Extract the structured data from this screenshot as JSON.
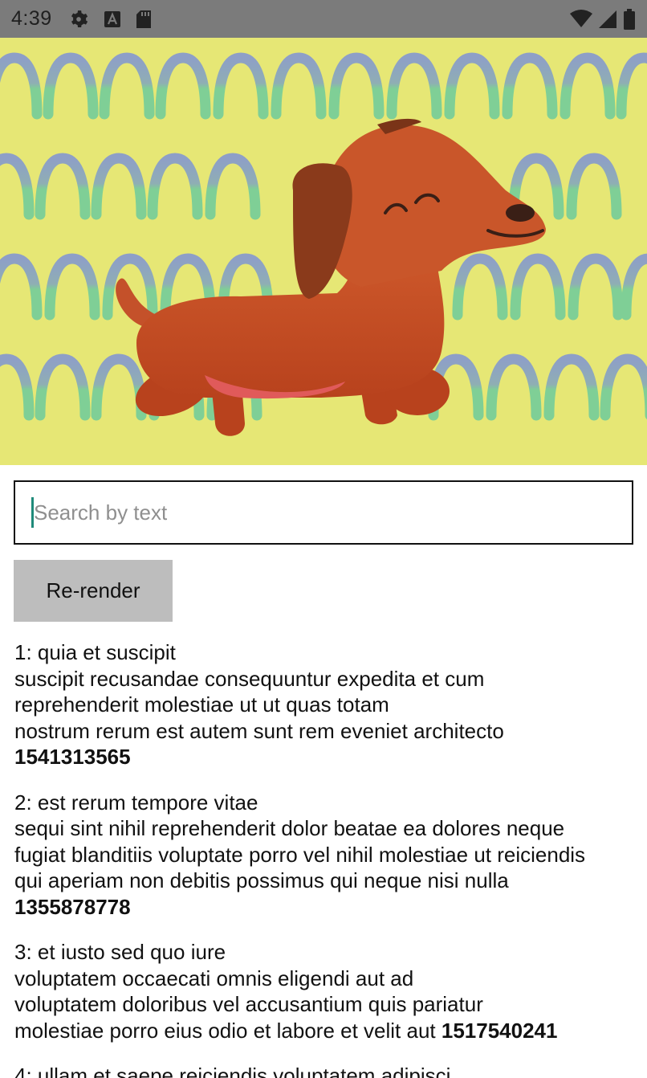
{
  "status_bar": {
    "time": "4:39",
    "left_icons": [
      "gear-icon",
      "a-icon",
      "sd-card-icon"
    ],
    "right_icons": [
      "wifi-icon",
      "signal-icon",
      "battery-icon"
    ]
  },
  "search": {
    "placeholder": "Search by text",
    "value": ""
  },
  "rerender_button": {
    "label": "Re-render"
  },
  "posts": [
    {
      "title": "1: quia et suscipit",
      "body": [
        "suscipit recusandae consequuntur expedita et cum",
        "reprehenderit molestiae ut ut quas totam",
        "nostrum rerum est autem sunt rem eveniet architecto"
      ],
      "number": "1541313565"
    },
    {
      "title": "2: est rerum tempore vitae",
      "body": [
        "sequi sint nihil reprehenderit dolor beatae ea dolores neque",
        "fugiat blanditiis voluptate porro vel nihil molestiae ut reiciendis",
        "qui aperiam non debitis possimus qui neque nisi nulla"
      ],
      "number": "1355878778"
    },
    {
      "title": "3: et iusto sed quo iure",
      "body": [
        "voluptatem occaecati omnis eligendi aut ad",
        "voluptatem doloribus vel accusantium quis pariatur",
        "molestiae porro eius odio et labore et velit aut"
      ],
      "number": "1517540241"
    },
    {
      "title": "4: ullam et saepe reiciendis voluptatem adipisci",
      "body": [],
      "number": ""
    }
  ],
  "colors": {
    "status_bar": "#7b7b7b",
    "hero_background": "#e6e775",
    "dog": "#c9562a",
    "caret": "#1f8a7a",
    "button": "#bdbdbd"
  }
}
